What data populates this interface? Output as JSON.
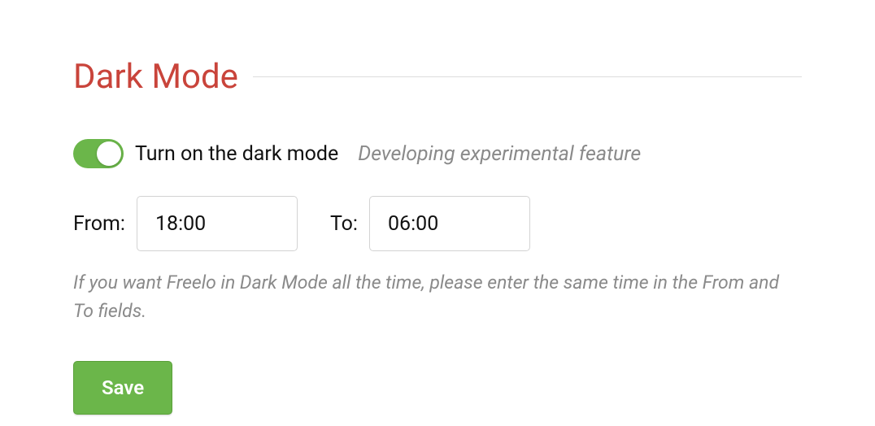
{
  "section": {
    "title": "Dark Mode"
  },
  "toggle": {
    "label": "Turn on the dark mode",
    "hint": "Developing experimental feature",
    "enabled": true
  },
  "time": {
    "from_label": "From:",
    "from_value": "18:00",
    "to_label": "To:",
    "to_value": "06:00"
  },
  "help_text": "If you want Freelo in Dark Mode all the time, please enter the same time in the From and To fields.",
  "buttons": {
    "save": "Save"
  }
}
